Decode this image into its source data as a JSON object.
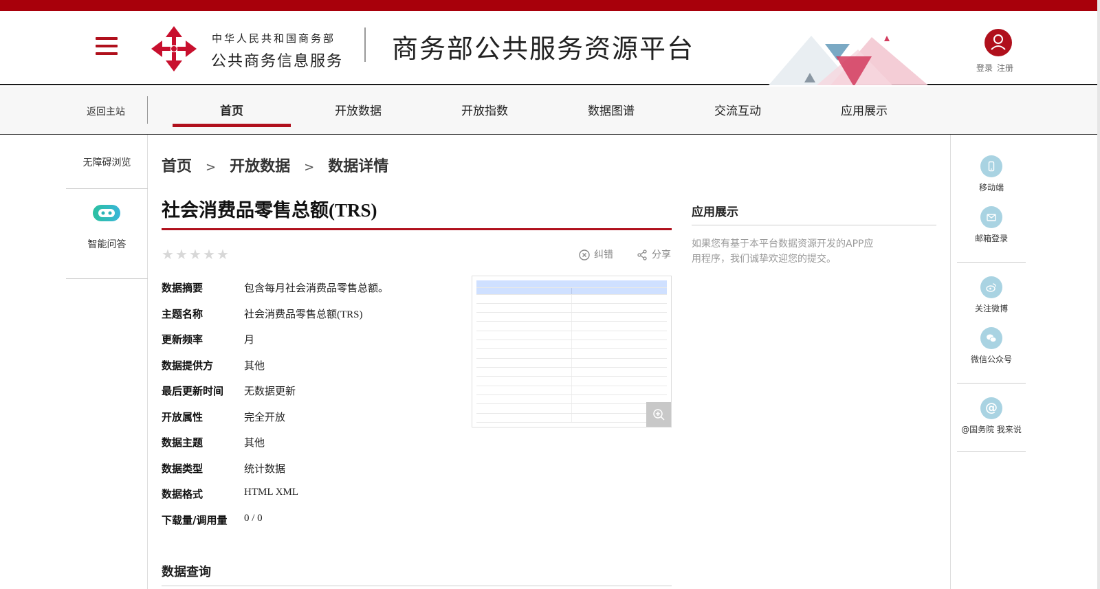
{
  "header": {
    "org_line1": "中华人民共和国商务部",
    "org_line2": "公共商务信息服务",
    "site_title": "商务部公共服务资源平台",
    "login": "登录",
    "register": "注册"
  },
  "nav": {
    "back": "返回主站",
    "items": [
      "首页",
      "开放数据",
      "开放指数",
      "数据图谱",
      "交流互动",
      "应用展示"
    ],
    "active_index": 0
  },
  "left_sidebar": {
    "accessibility": "无障碍浏览",
    "qa": "智能问答"
  },
  "breadcrumb": {
    "items": [
      "首页",
      "开放数据",
      "数据详情"
    ],
    "separator": ">"
  },
  "dataset": {
    "title": "社会消费品零售总额(TRS)",
    "rating": 0,
    "rating_max": 5,
    "actions": {
      "report": "纠错",
      "share": "分享"
    },
    "fields": [
      {
        "key": "数据摘要",
        "value": "包含每月社会消费品零售总额。"
      },
      {
        "key": "主题名称",
        "value": "社会消费品零售总额(TRS)"
      },
      {
        "key": "更新频率",
        "value": "月"
      },
      {
        "key": "数据提供方",
        "value": "其他"
      },
      {
        "key": "最后更新时间",
        "value": "无数据更新"
      },
      {
        "key": "开放属性",
        "value": "完全开放"
      },
      {
        "key": "数据主题",
        "value": "其他"
      },
      {
        "key": "数据类型",
        "value": "统计数据"
      },
      {
        "key": "数据格式",
        "value": "HTML XML"
      },
      {
        "key": "下载量/调用量",
        "value": "0 / 0"
      }
    ]
  },
  "query": {
    "title": "数据查询"
  },
  "app_showcase": {
    "title": "应用展示",
    "description": "如果您有基于本平台数据资源开发的APP应用程序，我们诚挚欢迎您的提交。"
  },
  "right_sidebar": {
    "items": [
      {
        "label": "移动端",
        "icon": "mobile-icon"
      },
      {
        "label": "邮箱登录",
        "icon": "mail-icon"
      },
      {
        "label": "关注微博",
        "icon": "weibo-icon"
      },
      {
        "label": "微信公众号",
        "icon": "wechat-icon"
      },
      {
        "label": "@国务院 我来说",
        "icon": "at-icon"
      }
    ]
  },
  "colors": {
    "brand_red": "#b0101c",
    "top_strip": "#a8000b",
    "side_icon_bg": "#a9d3e2"
  }
}
